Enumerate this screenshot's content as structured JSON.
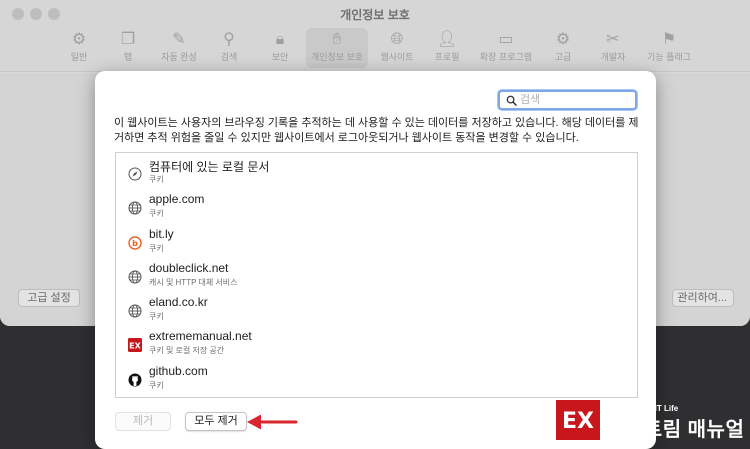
{
  "window": {
    "title": "개인정보 보호"
  },
  "toolbar": {
    "items": [
      {
        "label": "일반",
        "icon": "gear-icon"
      },
      {
        "label": "탭",
        "icon": "tabs-icon"
      },
      {
        "label": "자동 완성",
        "icon": "pencil-form-icon"
      },
      {
        "label": "검색",
        "icon": "search-icon"
      },
      {
        "label": "보안",
        "icon": "lock-icon"
      },
      {
        "label": "개인정보 보호",
        "icon": "hand-icon"
      },
      {
        "label": "웹사이트",
        "icon": "globe-icon"
      },
      {
        "label": "프로필",
        "icon": "person-icon"
      },
      {
        "label": "확장 프로그램",
        "icon": "puzzle-icon"
      },
      {
        "label": "고급",
        "icon": "gears-icon"
      },
      {
        "label": "개발자",
        "icon": "tools-icon"
      },
      {
        "label": "기능 플래그",
        "icon": "flag-icon"
      }
    ]
  },
  "prefs": {
    "advanced_label": "고급 설정",
    "manage_label": "관리하여..."
  },
  "sheet": {
    "search_placeholder": "검색",
    "description": "이 웹사이트는 사용자의 브라우징 기록을 추적하는 데 사용할 수 있는 데이터를 저장하고 있습니다. 해당 데이터를 제거하면 추적 위험을 줄일 수 있지만 웹사이트에서 로그아웃되거나 웹사이트 동작을 변경할 수 있습니다.",
    "sites": [
      {
        "name": "컴퓨터에 있는 로컬 문서",
        "sub": "쿠키",
        "icon": "compass-icon"
      },
      {
        "name": "apple.com",
        "sub": "쿠키",
        "icon": "globe-icon"
      },
      {
        "name": "bit.ly",
        "sub": "쿠키",
        "icon": "bitly-icon"
      },
      {
        "name": "doubleclick.net",
        "sub": "캐시 및 HTTP 대체 서비스",
        "icon": "globe-icon"
      },
      {
        "name": "eland.co.kr",
        "sub": "쿠키",
        "icon": "globe-icon"
      },
      {
        "name": "extrememanual.net",
        "sub": "쿠키 및 로컬 저장 공간",
        "icon": "ex-icon"
      },
      {
        "name": "github.com",
        "sub": "쿠키",
        "icon": "github-icon"
      }
    ],
    "remove_label": "제거",
    "remove_all_label": "모두 제거"
  },
  "watermark": {
    "tag": "More Better IT Life",
    "name": "익스트림 매뉴얼",
    "logo_text": "EX"
  },
  "colors": {
    "arrow": "#d9262e",
    "focus": "#7ea7e6",
    "brand_red": "#c8161d"
  }
}
